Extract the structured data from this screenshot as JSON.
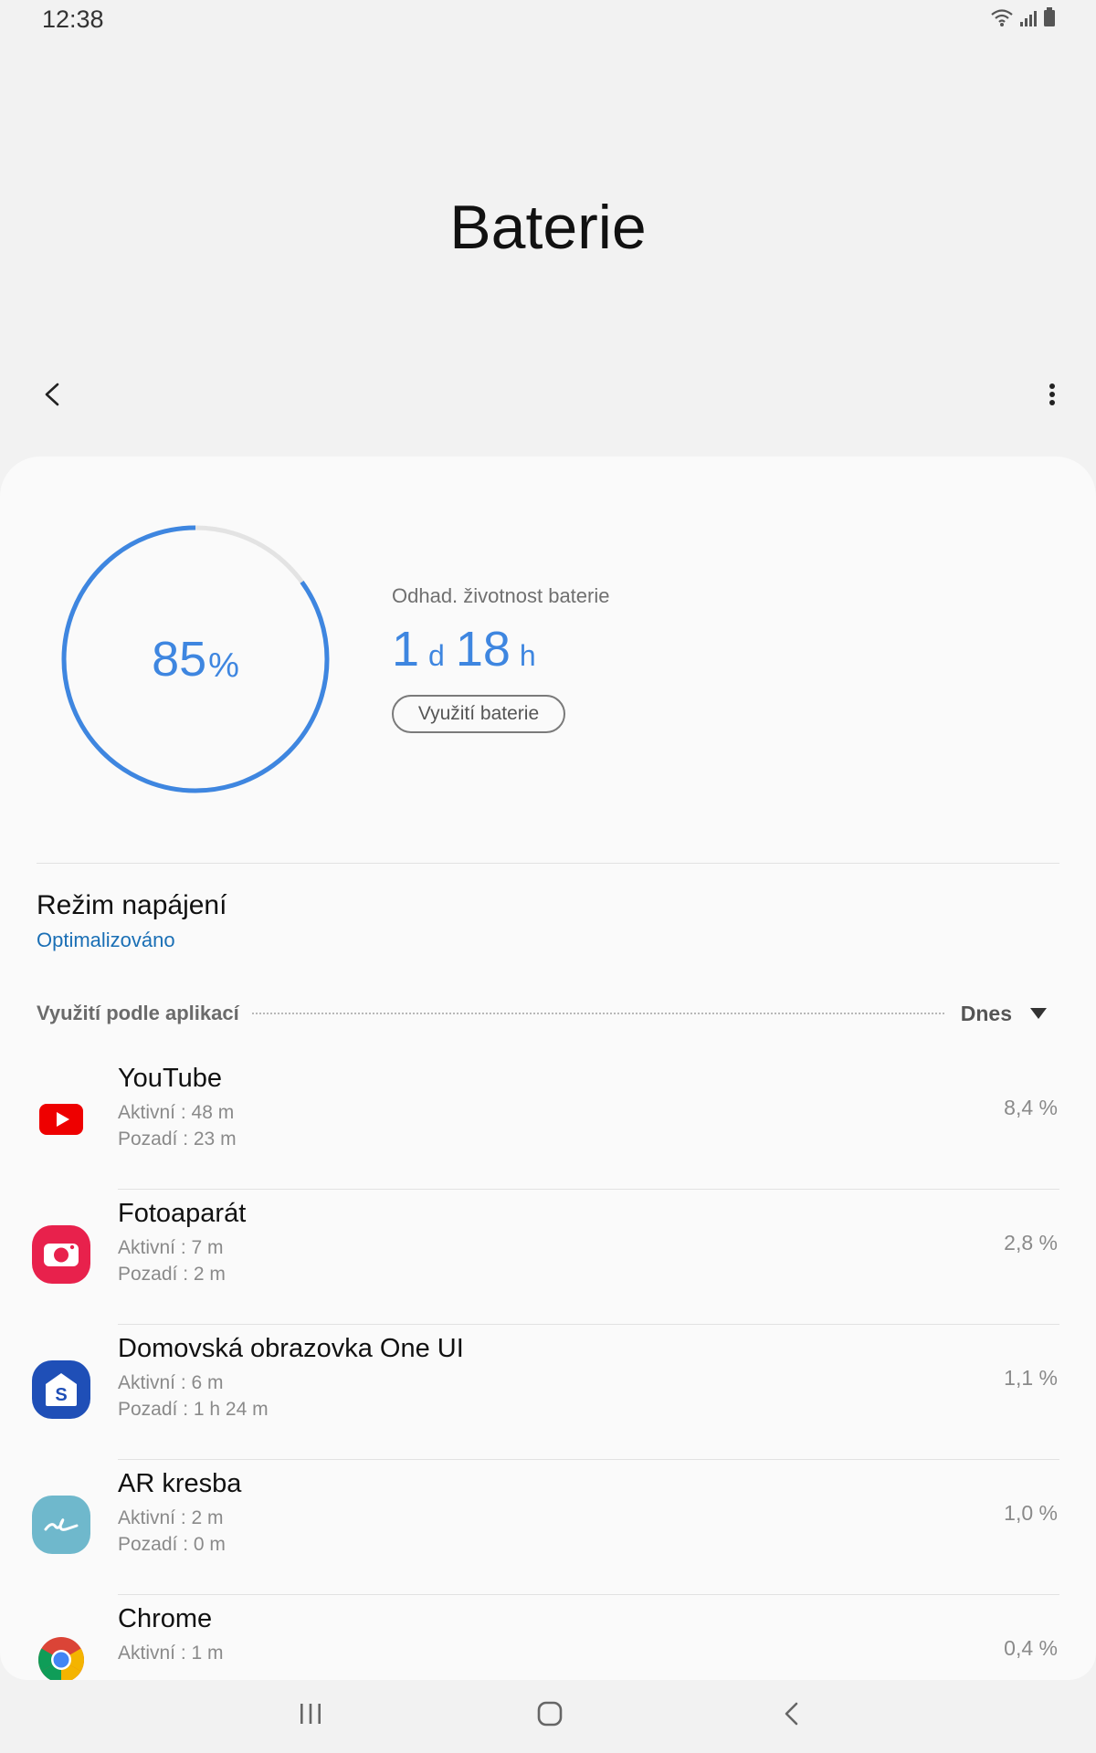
{
  "status_bar": {
    "time": "12:38",
    "icons": [
      "wifi-icon",
      "signal-icon",
      "battery-icon"
    ]
  },
  "header": {
    "title": "Baterie"
  },
  "battery": {
    "level_percent": 85,
    "level_value": "85",
    "unit": "%",
    "ring_color": "#3e86e0"
  },
  "estimate": {
    "label": "Odhad. životnost baterie",
    "days": "1",
    "days_unit": "d",
    "hours": "18",
    "hours_unit": "h",
    "button_label": "Využití baterie"
  },
  "power_mode": {
    "title": "Režim napájení",
    "value": "Optimalizováno"
  },
  "apps_section": {
    "label": "Využití podle aplikací",
    "period": "Dnes"
  },
  "apps": [
    {
      "name": "YouTube",
      "active": "Aktivní : 48 m",
      "background": "Pozadí : 23 m",
      "percent": "8,4 %",
      "icon": "youtube-icon"
    },
    {
      "name": "Fotoaparát",
      "active": "Aktivní : 7 m",
      "background": "Pozadí : 2 m",
      "percent": "2,8 %",
      "icon": "camera-icon"
    },
    {
      "name": "Domovská obrazovka One UI",
      "active": "Aktivní : 6 m",
      "background": "Pozadí : 1 h 24 m",
      "percent": "1,1 %",
      "icon": "one-ui-home-icon"
    },
    {
      "name": "AR kresba",
      "active": "Aktivní : 2 m",
      "background": "Pozadí : 0 m",
      "percent": "1,0 %",
      "icon": "ar-doodle-icon"
    },
    {
      "name": "Chrome",
      "active": "Aktivní : 1 m",
      "background": "",
      "percent": "0,4 %",
      "icon": "chrome-icon"
    }
  ],
  "navigation": {
    "buttons": [
      "recent-apps-icon",
      "home-icon",
      "back-icon"
    ]
  }
}
